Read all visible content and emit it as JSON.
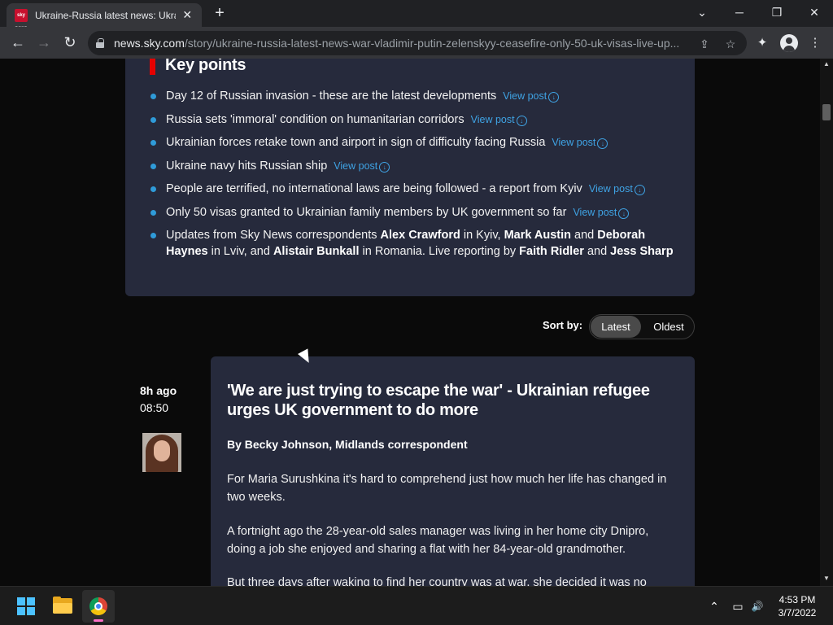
{
  "browser": {
    "tab_title": "Ukraine-Russia latest news: Ukraine-Russia latest news",
    "favicon_text": "sky news",
    "tab_close": "✕",
    "new_tab": "+",
    "url_host": "news.sky.com",
    "url_path": "/story/ukraine-russia-latest-news-war-vladimir-putin-zelenskyy-ceasefire-only-50-uk-visas-live-up...",
    "window_controls": {
      "dropdown": "⌄",
      "minimize": "─",
      "restore": "❐",
      "close": "✕"
    },
    "nav": {
      "back": "←",
      "forward": "→",
      "reload": "↻"
    },
    "toolbar_icons": {
      "share": "⇪",
      "star": "☆",
      "extensions": "✦",
      "menu": "⋮"
    }
  },
  "key_points": {
    "title": "Key points",
    "view_post_label": "View post",
    "items": [
      {
        "text": "Day 12 of Russian invasion - these are the latest developments"
      },
      {
        "text": "Russia sets 'immoral' condition on humanitarian corridors"
      },
      {
        "text": "Ukrainian forces retake town and airport in sign of difficulty facing Russia"
      },
      {
        "text": "Ukraine navy hits Russian ship"
      },
      {
        "text": "People are terrified, no international laws are being followed - a report from Kyiv"
      },
      {
        "text": "Only 50 visas granted to Ukrainian family members by UK government so far"
      }
    ],
    "updates": {
      "p1": "Updates from Sky News correspondents ",
      "n1": "Alex Crawford",
      "p2": " in Kyiv, ",
      "n2": "Mark Austin",
      "p3": " and ",
      "n3": "Deborah Haynes",
      "p4": " in Lviv, and ",
      "n4": "Alistair Bunkall",
      "p5": " in Romania. Live reporting by ",
      "n5": "Faith Ridler",
      "p6": " and ",
      "n6": "Jess Sharp"
    }
  },
  "sort": {
    "label": "Sort by:",
    "options": [
      "Latest",
      "Oldest"
    ],
    "selected": "Latest"
  },
  "post": {
    "time_ago": "8h ago",
    "time": "08:50",
    "title": "'We are just trying to escape the war' - Ukrainian refugee urges UK government to do more",
    "byline": "By Becky Johnson, Midlands correspondent",
    "paragraphs": [
      "For Maria Surushkina it's hard to comprehend just how much her life has changed in two weeks.",
      "A fortnight ago the 28-year-old sales manager was living in her home city Dnipro, doing a job she enjoyed and sharing a flat with her 84-year-old grandmother.",
      "But three days after waking to find her country was at war, she decided it was no"
    ]
  },
  "taskbar": {
    "time": "4:53 PM",
    "date": "3/7/2022",
    "tray_icons": {
      "chevron": "⌃",
      "network": "▭",
      "volume": "🔊"
    }
  },
  "colors": {
    "accent_blue": "#3fa3e4",
    "key_points_red": "#e50000",
    "card_bg": "#262a3c"
  }
}
